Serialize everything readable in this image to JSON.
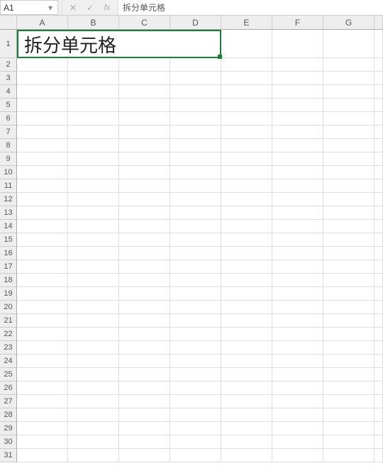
{
  "name_box": {
    "value": "A1"
  },
  "formula_bar": {
    "value": "拆分单元格"
  },
  "columns": [
    "A",
    "B",
    "C",
    "D",
    "E",
    "F",
    "G"
  ],
  "rows": [
    "1",
    "2",
    "3",
    "4",
    "5",
    "6",
    "7",
    "8",
    "9",
    "10",
    "11",
    "12",
    "13",
    "14",
    "15",
    "16",
    "17",
    "18",
    "19",
    "20",
    "21",
    "22",
    "23",
    "24",
    "25",
    "26",
    "27",
    "28",
    "29",
    "30",
    "31"
  ],
  "cells": {
    "A1": {
      "value": "拆分单元格",
      "merged_cols": 4
    }
  },
  "icons": {
    "cancel": "✕",
    "confirm": "✓",
    "fx": "fx",
    "dropdown": "▾"
  }
}
